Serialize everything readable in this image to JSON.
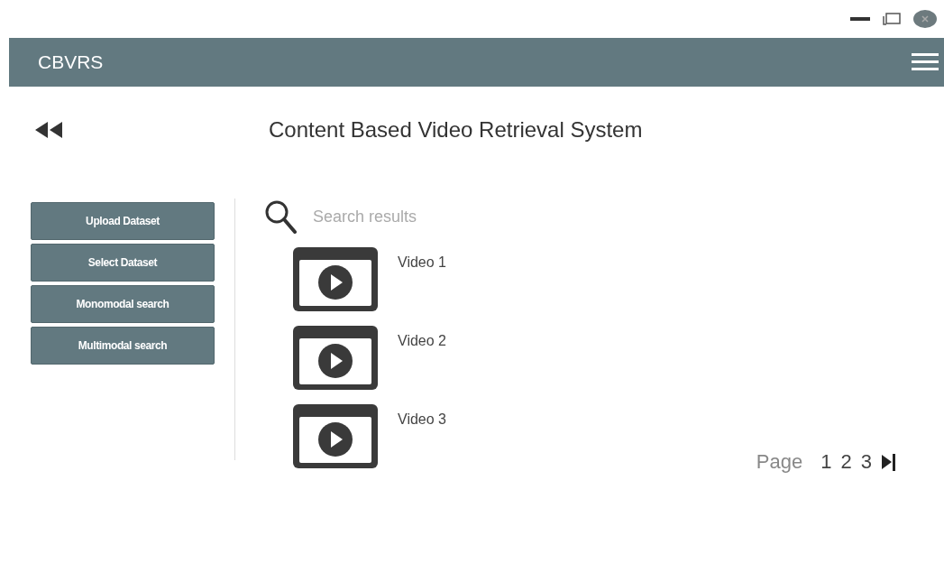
{
  "app": {
    "title": "CBVRS"
  },
  "page_title": "Content Based Video Retrieval System",
  "sidebar": {
    "buttons": [
      "Upload Dataset",
      "Select Dataset",
      "Monomodal search",
      "Multimodal search"
    ]
  },
  "search": {
    "placeholder": "Search results"
  },
  "results": [
    {
      "label": "Video 1"
    },
    {
      "label": "Video 2"
    },
    {
      "label": "Video 3"
    }
  ],
  "pagination": {
    "label": "Page",
    "pages": [
      "1",
      "2",
      "3"
    ]
  }
}
